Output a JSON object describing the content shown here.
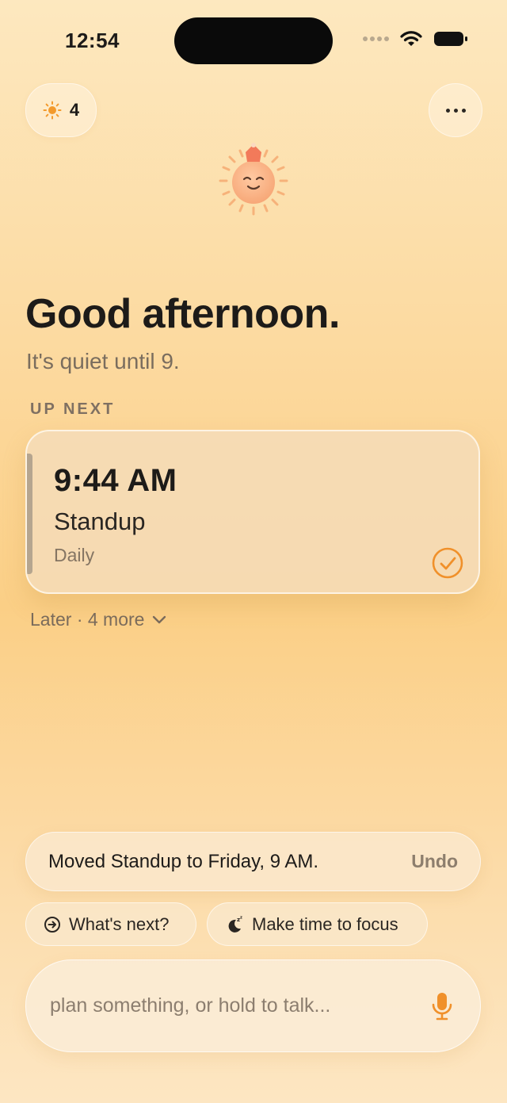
{
  "status_bar": {
    "time": "12:54"
  },
  "sun_chip": {
    "count": "4"
  },
  "greeting": {
    "title": "Good afternoon.",
    "subtitle": "It's quiet until 9."
  },
  "up_next": {
    "label": "UP NEXT",
    "event": {
      "time": "9:44 AM",
      "title": "Standup",
      "recurrence": "Daily"
    },
    "later_label": "Later · 4 more"
  },
  "toast": {
    "message": "Moved Standup to Friday, 9 AM.",
    "action": "Undo"
  },
  "suggestions": [
    {
      "label": "What's next?",
      "icon": "arrow-circle-icon"
    },
    {
      "label": "Make time to focus",
      "icon": "moon-sleep-icon"
    }
  ],
  "composer": {
    "placeholder": "plan something, or hold to talk..."
  },
  "colors": {
    "accent": "#f0902a",
    "text_primary": "#1d1b19",
    "text_secondary": "#7a6d5e"
  }
}
